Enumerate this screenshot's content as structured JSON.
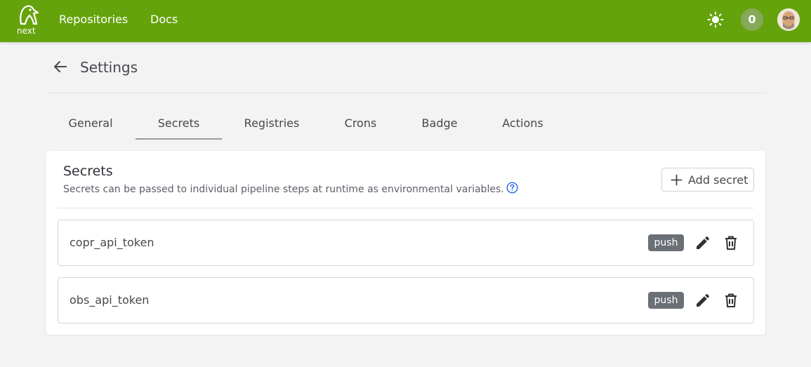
{
  "topbar": {
    "logo_label": "next",
    "nav": [
      {
        "label": "Repositories"
      },
      {
        "label": "Docs"
      }
    ],
    "running_pipelines": "0",
    "colors": {
      "bar": "#65a30d",
      "badge": "#85a85a"
    }
  },
  "header": {
    "title": "Settings"
  },
  "tabs": [
    {
      "label": "General",
      "active": false
    },
    {
      "label": "Secrets",
      "active": true
    },
    {
      "label": "Registries",
      "active": false
    },
    {
      "label": "Crons",
      "active": false
    },
    {
      "label": "Badge",
      "active": false
    },
    {
      "label": "Actions",
      "active": false
    }
  ],
  "secrets_panel": {
    "title": "Secrets",
    "description": "Secrets can be passed to individual pipeline steps at runtime as environmental variables.",
    "add_label": "Add secret",
    "items": [
      {
        "name": "copr_api_token",
        "event": "push"
      },
      {
        "name": "obs_api_token",
        "event": "push"
      }
    ]
  },
  "icons": {
    "logo": "penguin-logo-icon",
    "theme": "sun-icon",
    "back": "arrow-left-icon",
    "help": "question-circle-icon",
    "add": "plus-icon",
    "edit": "pencil-icon",
    "delete": "trash-icon"
  }
}
